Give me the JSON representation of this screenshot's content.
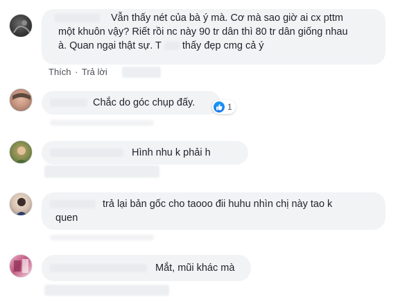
{
  "comments": [
    {
      "text_lines": [
        "Vẫn thấy nét của bà ý mà. Cơ mà sao giờ ai cx pttm",
        "một khuôn vậy? Riết rồi nc này 90 tr dân thì 80 tr dân giống nhau",
        "à. Quan ngại thật sự. T",
        "thấy đẹp cmg cả ý"
      ],
      "actions": {
        "like": "Thích",
        "sep": "·",
        "reply": "Trả lời"
      }
    },
    {
      "text": "Chắc do góc chụp đấy.",
      "reaction_count": "1",
      "reaction_color": "#1877f2"
    },
    {
      "text": "Hình nhu k phải h"
    },
    {
      "text_lines": [
        "trả lại bản gốc cho taooo đii huhu nhìn chị này tao k",
        "quen"
      ]
    },
    {
      "text": "Mắt, mũi khác mà"
    }
  ]
}
